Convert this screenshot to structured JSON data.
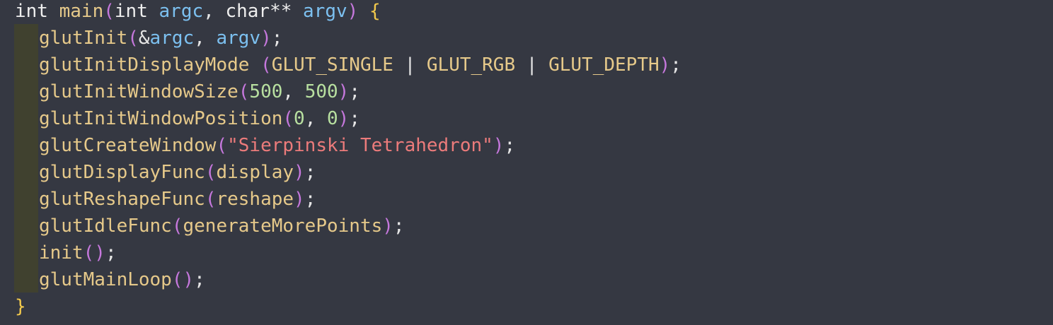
{
  "editor": {
    "lines": [
      {
        "id": "line-1",
        "tokens": [
          {
            "t": "int",
            "c": "kw"
          },
          {
            "t": " ",
            "c": "punct"
          },
          {
            "t": "main",
            "c": "fn"
          },
          {
            "t": "(",
            "c": "paren"
          },
          {
            "t": "int",
            "c": "kw"
          },
          {
            "t": " ",
            "c": "punct"
          },
          {
            "t": "argc",
            "c": "var"
          },
          {
            "t": ", ",
            "c": "punct"
          },
          {
            "t": "char**",
            "c": "kw"
          },
          {
            "t": " ",
            "c": "punct"
          },
          {
            "t": "argv",
            "c": "var"
          },
          {
            "t": ")",
            "c": "paren"
          },
          {
            "t": " ",
            "c": "punct"
          },
          {
            "t": "{",
            "c": "brace"
          }
        ]
      },
      {
        "id": "line-2",
        "tokens": [
          {
            "t": "glutInit",
            "c": "fn"
          },
          {
            "t": "(",
            "c": "paren"
          },
          {
            "t": "&",
            "c": "punct"
          },
          {
            "t": "argc",
            "c": "var"
          },
          {
            "t": ", ",
            "c": "punct"
          },
          {
            "t": "argv",
            "c": "var"
          },
          {
            "t": ")",
            "c": "paren"
          },
          {
            "t": ";",
            "c": "punct"
          }
        ]
      },
      {
        "id": "line-3",
        "tokens": [
          {
            "t": "glutInitDisplayMode",
            "c": "fn"
          },
          {
            "t": " ",
            "c": "punct"
          },
          {
            "t": "(",
            "c": "paren"
          },
          {
            "t": "GLUT_SINGLE",
            "c": "macro"
          },
          {
            "t": " | ",
            "c": "punct"
          },
          {
            "t": "GLUT_RGB",
            "c": "macro"
          },
          {
            "t": " | ",
            "c": "punct"
          },
          {
            "t": "GLUT_DEPTH",
            "c": "macro"
          },
          {
            "t": ")",
            "c": "paren"
          },
          {
            "t": ";",
            "c": "punct"
          }
        ]
      },
      {
        "id": "line-4",
        "tokens": [
          {
            "t": "glutInitWindowSize",
            "c": "fn"
          },
          {
            "t": "(",
            "c": "paren"
          },
          {
            "t": "500",
            "c": "num"
          },
          {
            "t": ", ",
            "c": "punct"
          },
          {
            "t": "500",
            "c": "num"
          },
          {
            "t": ")",
            "c": "paren"
          },
          {
            "t": ";",
            "c": "punct"
          }
        ]
      },
      {
        "id": "line-5",
        "tokens": [
          {
            "t": "glutInitWindowPosition",
            "c": "fn"
          },
          {
            "t": "(",
            "c": "paren"
          },
          {
            "t": "0",
            "c": "num"
          },
          {
            "t": ", ",
            "c": "punct"
          },
          {
            "t": "0",
            "c": "num"
          },
          {
            "t": ")",
            "c": "paren"
          },
          {
            "t": ";",
            "c": "punct"
          }
        ]
      },
      {
        "id": "line-6",
        "tokens": [
          {
            "t": "glutCreateWindow",
            "c": "fn"
          },
          {
            "t": "(",
            "c": "paren"
          },
          {
            "t": "\"Sierpinski Tetrahedron\"",
            "c": "str"
          },
          {
            "t": ")",
            "c": "paren"
          },
          {
            "t": ";",
            "c": "punct"
          }
        ]
      },
      {
        "id": "line-7",
        "tokens": [
          {
            "t": "glutDisplayFunc",
            "c": "fn"
          },
          {
            "t": "(",
            "c": "paren"
          },
          {
            "t": "display",
            "c": "fn"
          },
          {
            "t": ")",
            "c": "paren"
          },
          {
            "t": ";",
            "c": "punct"
          }
        ]
      },
      {
        "id": "line-8",
        "tokens": [
          {
            "t": "glutReshapeFunc",
            "c": "fn"
          },
          {
            "t": "(",
            "c": "paren"
          },
          {
            "t": "reshape",
            "c": "fn"
          },
          {
            "t": ")",
            "c": "paren"
          },
          {
            "t": ";",
            "c": "punct"
          }
        ]
      },
      {
        "id": "line-9",
        "tokens": [
          {
            "t": "glutIdleFunc",
            "c": "fn"
          },
          {
            "t": "(",
            "c": "paren"
          },
          {
            "t": "generateMorePoints",
            "c": "fn"
          },
          {
            "t": ")",
            "c": "paren"
          },
          {
            "t": ";",
            "c": "punct"
          }
        ]
      },
      {
        "id": "line-10",
        "tokens": [
          {
            "t": "init",
            "c": "fn"
          },
          {
            "t": "(",
            "c": "paren"
          },
          {
            "t": ")",
            "c": "paren"
          },
          {
            "t": ";",
            "c": "punct"
          }
        ]
      },
      {
        "id": "line-11",
        "tokens": [
          {
            "t": "glutMainLoop",
            "c": "fn"
          },
          {
            "t": "(",
            "c": "paren"
          },
          {
            "t": ")",
            "c": "paren"
          },
          {
            "t": ";",
            "c": "punct"
          }
        ]
      },
      {
        "id": "line-12",
        "tokens": [
          {
            "t": "}",
            "c": "brace"
          }
        ]
      }
    ]
  },
  "colors": {
    "background": "#353842",
    "indent_guide": "#40412f",
    "keyword": "#eeeeee",
    "function": "#e6c98a",
    "variable": "#7cc0f0",
    "paren": "#c678dd",
    "brace": "#f2c94c",
    "number": "#b8e0a0",
    "string": "#ec7b7b"
  }
}
